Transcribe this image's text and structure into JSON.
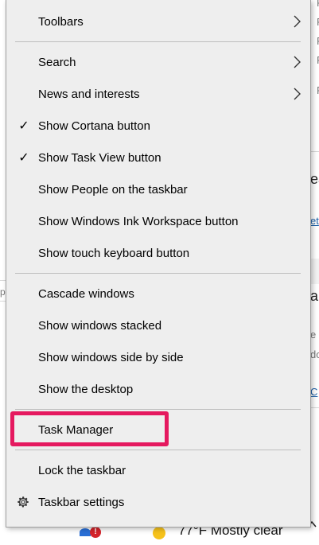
{
  "menu": {
    "items": [
      {
        "label": "Toolbars",
        "checked": false,
        "submenu": true
      },
      {
        "label": "Search",
        "checked": false,
        "submenu": true
      },
      {
        "label": "News and interests",
        "checked": false,
        "submenu": true
      },
      {
        "label": "Show Cortana button",
        "checked": true,
        "submenu": false
      },
      {
        "label": "Show Task View button",
        "checked": true,
        "submenu": false
      },
      {
        "label": "Show People on the taskbar",
        "checked": false,
        "submenu": false
      },
      {
        "label": "Show Windows Ink Workspace button",
        "checked": false,
        "submenu": false
      },
      {
        "label": "Show touch keyboard button",
        "checked": false,
        "submenu": false
      },
      {
        "label": "Cascade windows",
        "checked": false,
        "submenu": false
      },
      {
        "label": "Show windows stacked",
        "checked": false,
        "submenu": false
      },
      {
        "label": "Show windows side by side",
        "checked": false,
        "submenu": false
      },
      {
        "label": "Show the desktop",
        "checked": false,
        "submenu": false
      },
      {
        "label": "Task Manager",
        "checked": false,
        "submenu": false,
        "highlighted": true
      },
      {
        "label": "Lock the taskbar",
        "checked": false,
        "submenu": false
      },
      {
        "label": "Taskbar settings",
        "checked": false,
        "submenu": false,
        "icon": "gear-icon"
      }
    ],
    "check_glyph": "✓"
  },
  "background": {
    "right_fragments": [
      "F",
      "F",
      "F",
      "F",
      "F",
      "ea",
      "et",
      "ab",
      "e",
      "do",
      "C"
    ],
    "left_fragment": "p"
  },
  "taskbar": {
    "weather_text": "77°F  Mostly clear",
    "alert_badge": "!",
    "icons": [
      "app-icon",
      "weather-sun-icon",
      "chevron-up-icon"
    ]
  },
  "colors": {
    "menu_bg": "#eeeeee",
    "highlight": "#e5195f",
    "link": "#1a5fa8"
  }
}
